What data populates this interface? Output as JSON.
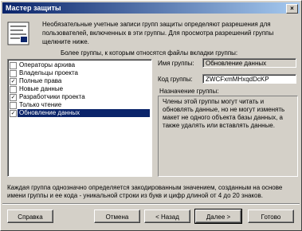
{
  "window": {
    "title": "Мастер защиты",
    "close_glyph": "×"
  },
  "intro": {
    "text": "Необязательные учетные записи групп защиты определяют разрешения для пользователей, включенных в эти группы. Для просмотра разрешений группы щелкните ниже."
  },
  "subhead": "Более группы, к которым относятся файлы вкладки группы:",
  "groups": [
    {
      "label": "Операторы архива",
      "checked": false,
      "selected": false
    },
    {
      "label": "Владельцы проекта",
      "checked": false,
      "selected": false
    },
    {
      "label": "Полные права",
      "checked": true,
      "selected": false
    },
    {
      "label": "Новые данные",
      "checked": false,
      "selected": false
    },
    {
      "label": "Разработчики проекта",
      "checked": true,
      "selected": false
    },
    {
      "label": "Только чтение",
      "checked": false,
      "selected": false
    },
    {
      "label": "Обновление данных",
      "checked": true,
      "selected": true
    }
  ],
  "fields": {
    "group_name_label": "Имя группы:",
    "group_name_value": "Обновление данных",
    "group_code_label": "Код группы:",
    "group_code_value": "ZWCFxmMHxqdDcKP",
    "description_label": "Назначение группы:",
    "description_text": "Члены этой группы могут читать и обновлять данные, но не могут изменять макет не одного объекта базы данных, а также удалять или вставлять данные."
  },
  "footnote": "Каждая группа однозначно определяется закодированным значением, созданным на основе имени группы и ее кода - уникальной строки из букв и цифр длиной от 4 до 20 знаков.",
  "buttons": {
    "help": "Справка",
    "cancel": "Отмена",
    "back": "< Назад",
    "next": "Далее >",
    "finish": "Готово"
  },
  "colors": {
    "selection": "#0a246a",
    "face": "#d4d0c8"
  }
}
